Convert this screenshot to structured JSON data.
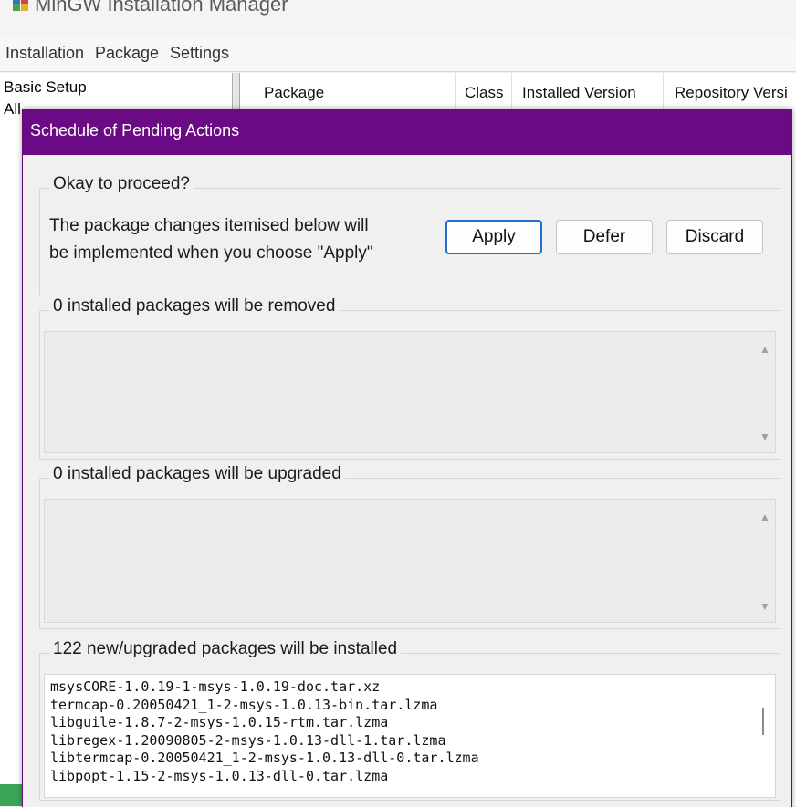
{
  "window": {
    "title": "MinGW Installation Manager"
  },
  "menubar": {
    "items": [
      "Installation",
      "Package",
      "Settings"
    ]
  },
  "left_pane": {
    "items": [
      "Basic Setup",
      "All"
    ]
  },
  "package_list": {
    "columns": [
      "Package",
      "Class",
      "Installed Version",
      "Repository Versi"
    ]
  },
  "dialog": {
    "title": "Schedule of Pending Actions",
    "proceed_group": {
      "legend": "Okay to proceed?",
      "message_line1": "The package changes itemised below will",
      "message_line2": "be implemented when you choose \"Apply\""
    },
    "buttons": {
      "apply": "Apply",
      "defer": "Defer",
      "discard": "Discard"
    },
    "removed_group": {
      "legend": "0 installed packages will be removed"
    },
    "upgraded_group": {
      "legend": "0 installed packages will be upgraded"
    },
    "installed_group": {
      "legend": "122 new/upgraded packages will be installed",
      "packages": [
        "msysCORE-1.0.19-1-msys-1.0.19-doc.tar.xz",
        "termcap-0.20050421_1-2-msys-1.0.13-bin.tar.lzma",
        "libguile-1.8.7-2-msys-1.0.15-rtm.tar.lzma",
        "libregex-1.20090805-2-msys-1.0.13-dll-1.tar.lzma",
        "libtermcap-0.20050421_1-2-msys-1.0.13-dll-0.tar.lzma",
        "libpopt-1.15-2-msys-1.0.13-dll-0.tar.lzma"
      ]
    }
  },
  "colors": {
    "dialog_titlebar": "#6a0a84",
    "primary_button_border": "#1f6fd1"
  },
  "icons": {
    "app": "mingw-app-icon",
    "scroll_up": "triangle-up",
    "scroll_down": "triangle-down"
  }
}
